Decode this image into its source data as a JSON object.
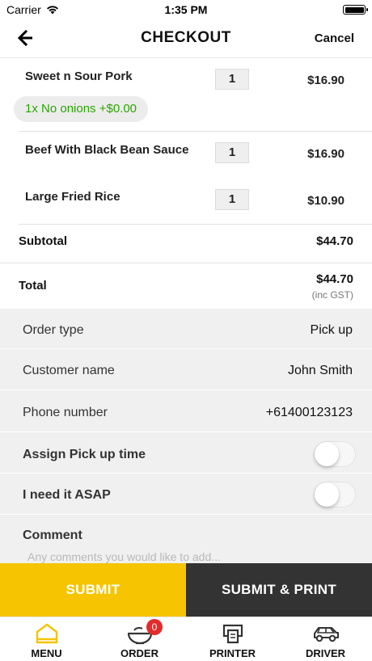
{
  "status_bar": {
    "carrier": "Carrier",
    "time": "1:35 PM"
  },
  "header": {
    "title": "CHECKOUT",
    "cancel_label": "Cancel",
    "back_icon": "arrow-left-icon"
  },
  "order_items": [
    {
      "name": "Sweet n Sour Pork",
      "quantity": "1",
      "price": "$16.90",
      "modifier": "1x No onions +$0.00"
    },
    {
      "name": "Beef With Black Bean Sauce",
      "quantity": "1",
      "price": "$16.90"
    },
    {
      "name": "Large Fried Rice",
      "quantity": "1",
      "price": "$10.90"
    }
  ],
  "summary": {
    "subtotal_label": "Subtotal",
    "subtotal_value": "$44.70",
    "total_label": "Total",
    "total_value": "$44.70",
    "gst_note": "(inc GST)"
  },
  "form": {
    "order_type_label": "Order type",
    "order_type_value": "Pick up",
    "customer_name_label": "Customer name",
    "customer_name_value": "John Smith",
    "phone_label": "Phone number",
    "phone_value": "+61400123123",
    "pickup_time_label": "Assign Pick up time",
    "pickup_time_on": false,
    "asap_label": "I need it ASAP",
    "asap_on": false,
    "comment_label": "Comment",
    "comment_placeholder": "Any comments you would like to add..."
  },
  "actions": {
    "submit_label": "SUBMIT",
    "submit_print_label": "SUBMIT & PRINT"
  },
  "tabbar": {
    "tabs": [
      {
        "label": "MENU",
        "icon": "menu-house-icon",
        "active": true
      },
      {
        "label": "ORDER",
        "icon": "order-bowl-icon",
        "badge": "0"
      },
      {
        "label": "PRINTER",
        "icon": "printer-icon"
      },
      {
        "label": "DRIVER",
        "icon": "car-icon"
      }
    ]
  },
  "colors": {
    "accent_yellow": "#f6c400",
    "dark_button": "#333333",
    "modifier_green": "#2aa600",
    "badge_red": "#e32b2b"
  }
}
